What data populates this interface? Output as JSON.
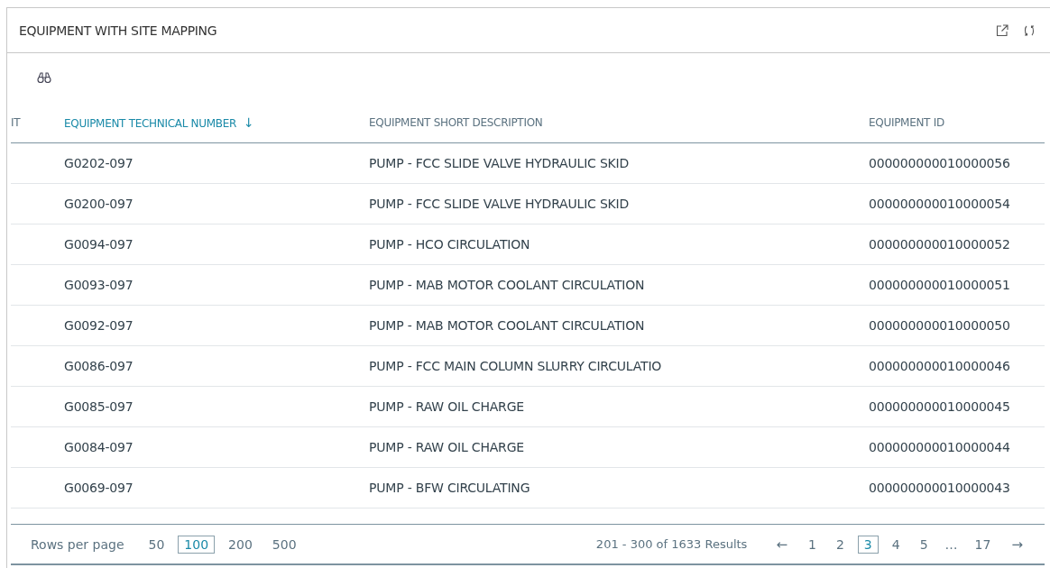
{
  "panel": {
    "title": "EQUIPMENT WITH SITE MAPPING"
  },
  "table": {
    "columns": [
      {
        "label": "IT",
        "sorted": false
      },
      {
        "label": "EQUIPMENT TECHNICAL NUMBER",
        "sorted": true,
        "sort_glyph": "↓"
      },
      {
        "label": "EQUIPMENT SHORT DESCRIPTION",
        "sorted": false
      },
      {
        "label": "EQUIPMENT ID",
        "sorted": false
      }
    ],
    "rows": [
      {
        "number": "G0202-097",
        "description": "PUMP - FCC SLIDE VALVE HYDRAULIC SKID",
        "id": "000000000010000056"
      },
      {
        "number": "G0200-097",
        "description": "PUMP - FCC SLIDE VALVE HYDRAULIC SKID",
        "id": "000000000010000054"
      },
      {
        "number": "G0094-097",
        "description": "PUMP - HCO CIRCULATION",
        "id": "000000000010000052"
      },
      {
        "number": "G0093-097",
        "description": "PUMP - MAB MOTOR COOLANT CIRCULATION",
        "id": "000000000010000051"
      },
      {
        "number": "G0092-097",
        "description": "PUMP - MAB MOTOR COOLANT CIRCULATION",
        "id": "000000000010000050"
      },
      {
        "number": "G0086-097",
        "description": "PUMP - FCC MAIN COLUMN SLURRY CIRCULATIO",
        "id": "000000000010000046"
      },
      {
        "number": "G0085-097",
        "description": "PUMP - RAW OIL CHARGE",
        "id": "000000000010000045"
      },
      {
        "number": "G0084-097",
        "description": "PUMP - RAW OIL CHARGE",
        "id": "000000000010000044"
      },
      {
        "number": "G0069-097",
        "description": "PUMP - BFW CIRCULATING",
        "id": "000000000010000043"
      }
    ]
  },
  "footer": {
    "rows_per_page_label": "Rows per page",
    "page_sizes": [
      {
        "label": "50",
        "selected": false
      },
      {
        "label": "100",
        "selected": true
      },
      {
        "label": "200",
        "selected": false
      },
      {
        "label": "500",
        "selected": false
      }
    ],
    "results": "201 - 300 of 1633 Results",
    "prev": "←",
    "next": "→",
    "pages": [
      {
        "label": "1",
        "selected": false
      },
      {
        "label": "2",
        "selected": false
      },
      {
        "label": "3",
        "selected": true
      },
      {
        "label": "4",
        "selected": false
      },
      {
        "label": "5",
        "selected": false
      },
      {
        "label": "…",
        "kind": "ellipsis"
      },
      {
        "label": "17",
        "selected": false
      }
    ]
  }
}
